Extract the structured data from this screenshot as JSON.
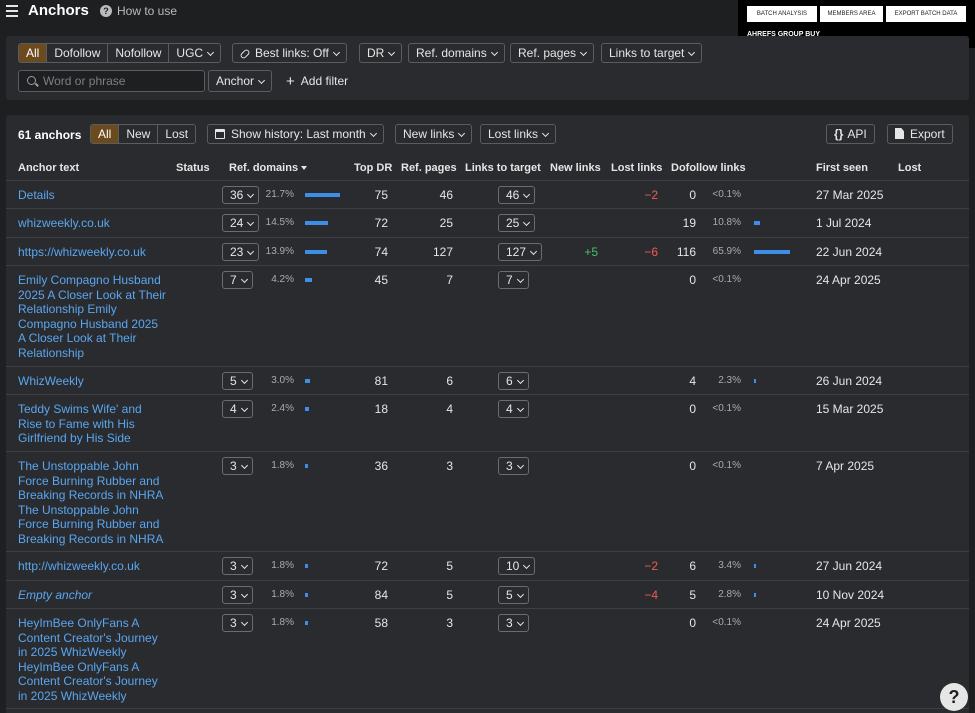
{
  "header": {
    "title": "Anchors",
    "help": "How to use",
    "help_icon": "question-circle-icon",
    "menu_icon": "hamburger-icon"
  },
  "overlay": {
    "buttons": [
      "BATCH ANALYSIS",
      "MEMBERS AREA",
      "EXPORT BATCH DATA"
    ],
    "label": "AHREFS GROUP BUY"
  },
  "filters": {
    "link_types": [
      "All",
      "Dofollow",
      "Nofollow",
      "UGC"
    ],
    "best_links": "Best links: Off",
    "dr": "DR",
    "ref_domains": "Ref. domains",
    "ref_pages": "Ref. pages",
    "links_to_target": "Links to target",
    "search_placeholder": "Word or phrase",
    "anchor_select": "Anchor",
    "add_filter": "Add filter"
  },
  "toolbar": {
    "count": "61 anchors",
    "tabs": [
      "All",
      "New",
      "Lost"
    ],
    "show_history": "Show history: Last month",
    "new_links": "New links",
    "lost_links": "Lost links",
    "api": "API",
    "export": "Export"
  },
  "accent_color": "#c8822b",
  "link_color": "#5aa6f0",
  "table": {
    "columns": [
      "Anchor text",
      "Status",
      "Ref. domains",
      "Top DR",
      "Ref. pages",
      "Links to target",
      "New links",
      "Lost links",
      "Dofollow links",
      "First seen",
      "Lost"
    ],
    "rows": [
      {
        "anchor": "Details",
        "refdom": "36",
        "refdom_pct": "21.7%",
        "refdom_share": 0.217,
        "top_dr": "75",
        "ref_pages": "46",
        "links": "46",
        "new": "",
        "lost": "−2",
        "dofollow": "0",
        "dofollow_pct": "<0.1%",
        "dofollow_share": 0,
        "first_seen": "27 Mar 2025"
      },
      {
        "anchor": "whizweekly.co.uk",
        "refdom": "24",
        "refdom_pct": "14.5%",
        "refdom_share": 0.145,
        "top_dr": "72",
        "ref_pages": "25",
        "links": "25",
        "new": "",
        "lost": "",
        "dofollow": "19",
        "dofollow_pct": "10.8%",
        "dofollow_share": 0.108,
        "first_seen": "1 Jul 2024"
      },
      {
        "anchor": "https://whizweekly.co.uk",
        "refdom": "23",
        "refdom_pct": "13.9%",
        "refdom_share": 0.139,
        "top_dr": "74",
        "ref_pages": "127",
        "links": "127",
        "new": "+5",
        "lost": "−6",
        "dofollow": "116",
        "dofollow_pct": "65.9%",
        "dofollow_share": 0.659,
        "first_seen": "22 Jun 2024"
      },
      {
        "anchor": "Emily Compagno Husband 2025 A Closer Look at Their Relationship Emily Compagno Husband 2025 A Closer Look at Their Relationship",
        "refdom": "7",
        "refdom_pct": "4.2%",
        "refdom_share": 0.042,
        "top_dr": "45",
        "ref_pages": "7",
        "links": "7",
        "new": "",
        "lost": "",
        "dofollow": "0",
        "dofollow_pct": "<0.1%",
        "dofollow_share": 0,
        "first_seen": "24 Apr 2025"
      },
      {
        "anchor": "WhizWeekly",
        "refdom": "5",
        "refdom_pct": "3.0%",
        "refdom_share": 0.03,
        "top_dr": "81",
        "ref_pages": "6",
        "links": "6",
        "new": "",
        "lost": "",
        "dofollow": "4",
        "dofollow_pct": "2.3%",
        "dofollow_share": 0.023,
        "first_seen": "26 Jun 2024"
      },
      {
        "anchor": "Teddy Swims Wife' and Rise to Fame with His Girlfriend by His Side",
        "refdom": "4",
        "refdom_pct": "2.4%",
        "refdom_share": 0.024,
        "top_dr": "18",
        "ref_pages": "4",
        "links": "4",
        "new": "",
        "lost": "",
        "dofollow": "0",
        "dofollow_pct": "<0.1%",
        "dofollow_share": 0,
        "first_seen": "15 Mar 2025"
      },
      {
        "anchor": "The Unstoppable John Force Burning Rubber and Breaking Records in NHRA The Unstoppable John Force Burning Rubber and Breaking Records in NHRA",
        "refdom": "3",
        "refdom_pct": "1.8%",
        "refdom_share": 0.018,
        "top_dr": "36",
        "ref_pages": "3",
        "links": "3",
        "new": "",
        "lost": "",
        "dofollow": "0",
        "dofollow_pct": "<0.1%",
        "dofollow_share": 0,
        "first_seen": "7 Apr 2025"
      },
      {
        "anchor": "http://whizweekly.co.uk",
        "refdom": "3",
        "refdom_pct": "1.8%",
        "refdom_share": 0.018,
        "top_dr": "72",
        "ref_pages": "5",
        "links": "10",
        "new": "",
        "lost": "−2",
        "dofollow": "6",
        "dofollow_pct": "3.4%",
        "dofollow_share": 0.034,
        "first_seen": "27 Jun 2024"
      },
      {
        "anchor": "Empty anchor",
        "italic": true,
        "refdom": "3",
        "refdom_pct": "1.8%",
        "refdom_share": 0.018,
        "top_dr": "84",
        "ref_pages": "5",
        "links": "5",
        "new": "",
        "lost": "−4",
        "dofollow": "5",
        "dofollow_pct": "2.8%",
        "dofollow_share": 0.028,
        "first_seen": "10 Nov 2024"
      },
      {
        "anchor": "HeyImBee OnlyFans A Content Creator's Journey in 2025 WhizWeekly HeyImBee OnlyFans A Content Creator's Journey in 2025 WhizWeekly",
        "refdom": "3",
        "refdom_pct": "1.8%",
        "refdom_share": 0.018,
        "top_dr": "58",
        "ref_pages": "3",
        "links": "3",
        "new": "",
        "lost": "",
        "dofollow": "0",
        "dofollow_pct": "<0.1%",
        "dofollow_share": 0,
        "first_seen": "24 Apr 2025"
      }
    ]
  },
  "help_button": "?"
}
